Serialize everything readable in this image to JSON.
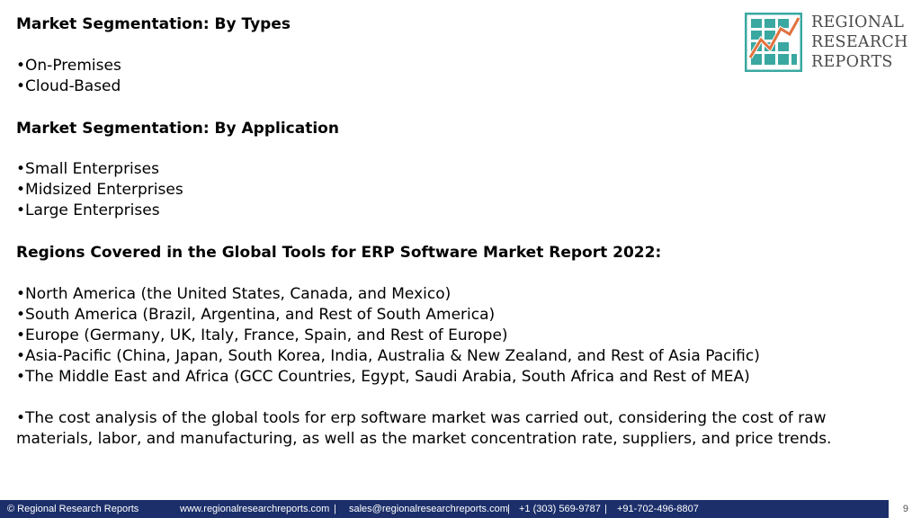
{
  "logo": {
    "line1": "REGIONAL",
    "line2": "RESEARCH",
    "line3": "REPORTS",
    "colors": {
      "teal": "#3aa8a1",
      "orange": "#e2713c",
      "text": "#4a4a4a"
    }
  },
  "types": {
    "heading": "Market Segmentation: By Types",
    "items": [
      "•On-Premises",
      "•Cloud-Based"
    ]
  },
  "application": {
    "heading": "Market Segmentation: By Application",
    "items": [
      "•Small Enterprises",
      "•Midsized Enterprises",
      "•Large Enterprises"
    ]
  },
  "regions": {
    "heading": "Regions Covered in the Global Tools for ERP Software Market Report 2022:",
    "items": [
      "•North America (the United States, Canada, and Mexico)",
      "•South America (Brazil, Argentina, and Rest of South America)",
      "•Europe (Germany, UK, Italy, France, Spain, and Rest of Europe)",
      "•Asia-Pacific (China, Japan, South Korea, India, Australia & New Zealand, and Rest of Asia Pacific)",
      "•The Middle East and Africa (GCC Countries, Egypt, Saudi Arabia, South Africa and Rest of MEA)"
    ]
  },
  "cost_analysis": "•The cost analysis of the global tools for erp software market was carried out, considering the cost of raw materials, labor, and manufacturing, as well as the market concentration rate, suppliers, and price trends.",
  "footer": {
    "copyright": "© Regional Research Reports",
    "website": "www.regionalresearchreports.com",
    "sep1": "|",
    "email": "sales@regionalresearchreports.com",
    "sep2": "|",
    "phone1": "+1 (303) 569-9787",
    "sep3": "|",
    "phone2": "+91-702-496-8807",
    "page_number": "9",
    "bar_color": "#1c2f6a"
  }
}
